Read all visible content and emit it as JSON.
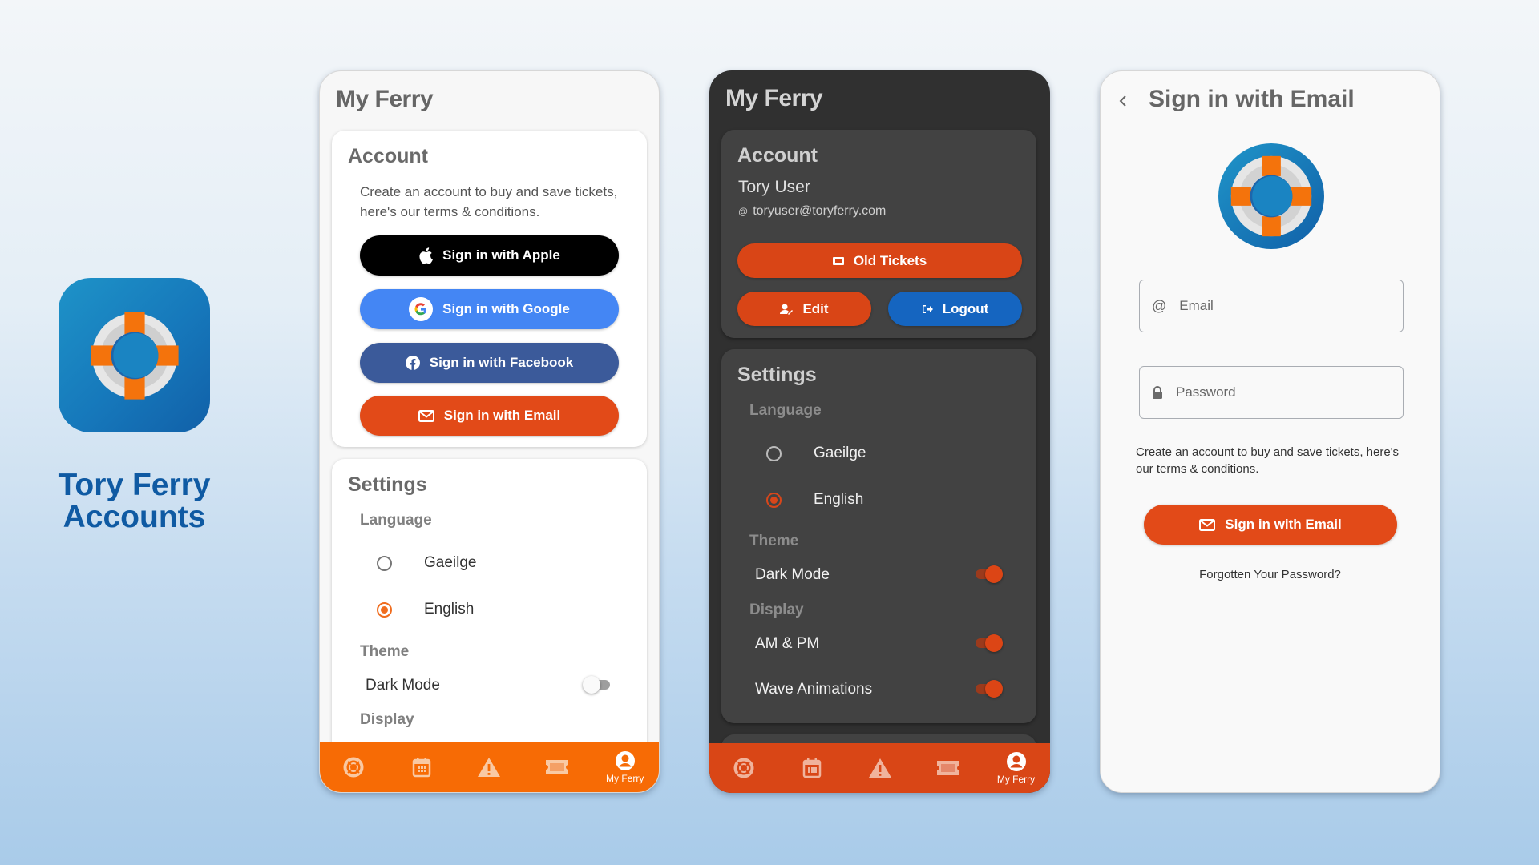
{
  "brand": {
    "title_line1": "Tory Ferry",
    "title_line2": "Accounts",
    "icon": "lifebuoy-icon"
  },
  "colors": {
    "brand_blue": "#0f5aa3",
    "orange_light": "#f76b05",
    "orange_dark": "#d94616",
    "email_red": "#e24a18",
    "apple_black": "#000000",
    "google_blue": "#4486f4",
    "facebook_blue": "#3b5a9a",
    "logout_blue": "#1565c0"
  },
  "light_screen": {
    "title": "My Ferry",
    "account": {
      "heading": "Account",
      "description": "Create an account to buy and save tickets, here's our terms & conditions.",
      "buttons": [
        {
          "label": "Sign in with Apple",
          "icon": "apple-icon"
        },
        {
          "label": "Sign in with Google",
          "icon": "google-icon"
        },
        {
          "label": "Sign in with Facebook",
          "icon": "facebook-icon"
        },
        {
          "label": "Sign in with Email",
          "icon": "envelope-icon"
        }
      ]
    },
    "settings": {
      "heading": "Settings",
      "language_label": "Language",
      "languages": [
        {
          "label": "Gaeilge",
          "selected": false
        },
        {
          "label": "English",
          "selected": true
        }
      ],
      "theme_label": "Theme",
      "dark_mode": {
        "label": "Dark Mode",
        "on": false
      },
      "display_label": "Display"
    },
    "nav": [
      {
        "icon": "lifebuoy-icon",
        "label": ""
      },
      {
        "icon": "calendar-icon",
        "label": ""
      },
      {
        "icon": "warning-icon",
        "label": ""
      },
      {
        "icon": "ticket-icon",
        "label": ""
      },
      {
        "icon": "user-circle-icon",
        "label": "My Ferry",
        "active": true
      }
    ]
  },
  "dark_screen": {
    "title": "My Ferry",
    "account": {
      "heading": "Account",
      "user_name": "Tory User",
      "user_email": "toryuser@toryferry.com",
      "old_tickets_label": "Old Tickets",
      "edit_label": "Edit",
      "logout_label": "Logout"
    },
    "settings": {
      "heading": "Settings",
      "language_label": "Language",
      "languages": [
        {
          "label": "Gaeilge",
          "selected": false
        },
        {
          "label": "English",
          "selected": true
        }
      ],
      "theme_label": "Theme",
      "dark_mode": {
        "label": "Dark Mode",
        "on": true
      },
      "display_label": "Display",
      "am_pm": {
        "label": "AM & PM",
        "on": true
      },
      "wave_animations": {
        "label": "Wave Animations",
        "on": true
      }
    },
    "nav": [
      {
        "icon": "lifebuoy-icon",
        "label": ""
      },
      {
        "icon": "calendar-icon",
        "label": ""
      },
      {
        "icon": "warning-icon",
        "label": ""
      },
      {
        "icon": "ticket-icon",
        "label": ""
      },
      {
        "icon": "user-circle-icon",
        "label": "My Ferry",
        "active": true
      }
    ]
  },
  "email_screen": {
    "title": "Sign in with Email",
    "email_placeholder": "Email",
    "password_placeholder": "Password",
    "description": "Create an account to buy and save tickets, here's our terms & conditions.",
    "sign_in_label": "Sign in with Email",
    "forgot_label": "Forgotten Your Password?"
  }
}
